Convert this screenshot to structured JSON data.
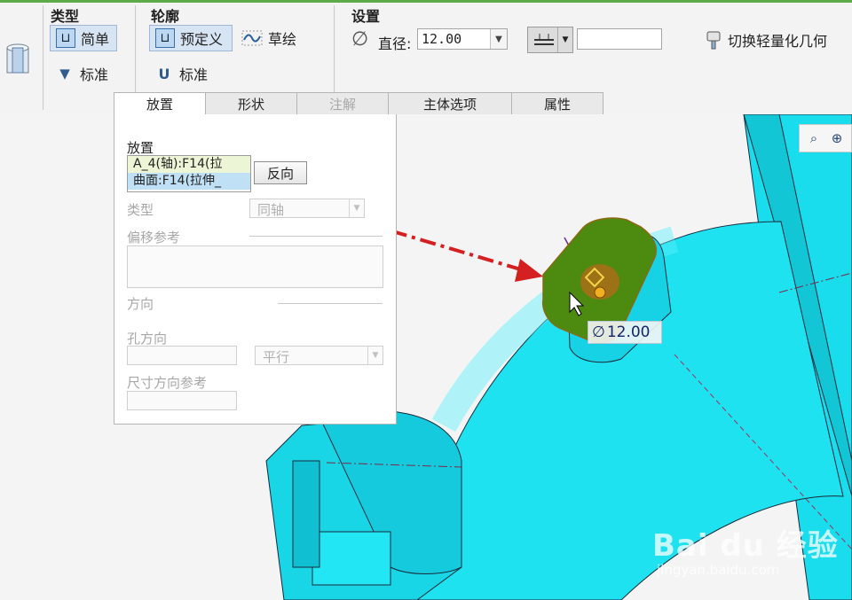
{
  "ribbon": {
    "type_group": {
      "title": "类型",
      "simple_label": "简单",
      "standard_label": "标准"
    },
    "profile_group": {
      "title": "轮廓",
      "predefined_label": "预定义",
      "sketch_label": "草绘",
      "standard_label": "标准"
    },
    "settings_group": {
      "title": "设置",
      "diameter_label": "直径:",
      "diameter_value": "12.00",
      "depth_value": ""
    },
    "toggle_lightweight_label": "切换轻量化几何"
  },
  "tabs": [
    {
      "label": "放置",
      "state": "active"
    },
    {
      "label": "形状",
      "state": "normal"
    },
    {
      "label": "注解",
      "state": "disabled"
    },
    {
      "label": "主体选项",
      "state": "normal"
    },
    {
      "label": "属性",
      "state": "normal"
    }
  ],
  "placement_panel": {
    "placement_label": "放置",
    "references": [
      "A_4(轴):F14(拉",
      "曲面:F14(拉伸_"
    ],
    "flip_button": "反向",
    "type_label": "类型",
    "type_value": "同轴",
    "offset_refs_label": "偏移参考",
    "direction_label": "方向",
    "hole_direction_label": "孔方向",
    "hole_direction_value": "平行",
    "dimension_ref_label": "尺寸方向参考"
  },
  "viewport": {
    "dimension_symbol": "∅",
    "dimension_value": "12.00",
    "model_color": "#1ce4f0",
    "hole_preview_color": "#4d8a10",
    "arrow_color": "#d42020"
  },
  "watermark": {
    "brand": "Bai du 经验",
    "url": "jingyan.baidu.com"
  }
}
